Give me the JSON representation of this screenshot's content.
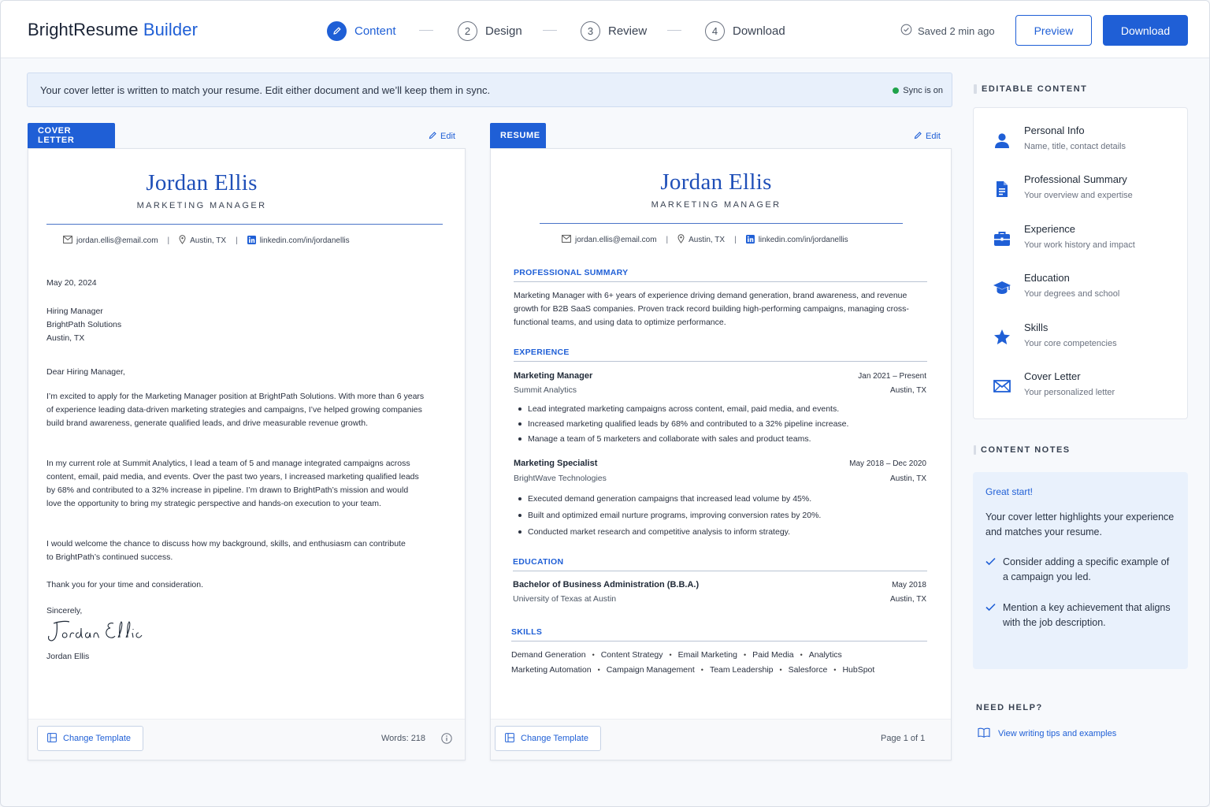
{
  "header": {
    "brand_main": "BrightResume",
    "brand_accent": "Builder",
    "steps": [
      {
        "num": "1",
        "label": "Content"
      },
      {
        "num": "2",
        "label": "Design"
      },
      {
        "num": "3",
        "label": "Review"
      },
      {
        "num": "4",
        "label": "Download"
      }
    ],
    "active_step": "Content",
    "saved_status": "Saved 2 min ago",
    "preview_label": "Preview",
    "download_label": "Download"
  },
  "banner": {
    "message": "Your cover letter is written to match your resume. Edit either document and we’ll keep them in sync.",
    "sync_label": "Sync is on",
    "sync_color": "#1fa34a"
  },
  "contact": {
    "name": "Jordan Ellis",
    "title": "MARKETING MANAGER",
    "email": "jordan.ellis@email.com",
    "location": "Austin, TX",
    "linkedin": "linkedin.com/in/jordanellis"
  },
  "cover_letter": {
    "tab_label": "COVER LETTER",
    "edit_label": "Edit",
    "date": "May 20, 2024",
    "recipient": [
      "Hiring Manager",
      "BrightPath Solutions",
      "Austin, TX"
    ],
    "salutation": "Dear Hiring Manager,",
    "paragraphs": [
      "I’m excited to apply for the Marketing Manager position at BrightPath Solutions. With more than 6 years of experience leading data-driven marketing strategies and campaigns, I’ve helped growing companies build brand awareness, generate qualified leads, and drive measurable revenue growth.",
      "In my current role at Summit Analytics, I lead a team of 5 and manage integrated campaigns across content, email, paid media, and events. Over the past two years, I increased marketing qualified leads by 68% and contributed to a 32% increase in pipeline. I’m drawn to BrightPath’s mission and would love the opportunity to bring my strategic perspective and hands-on execution to your team.",
      "I would welcome the chance to discuss how my background, skills, and enthusiasm can contribute to BrightPath’s continued success.",
      "Thank you for your time and consideration."
    ],
    "closing": "Sincerely,",
    "signature": "Jordan Ellis",
    "signed_name": "Jordan Ellis",
    "change_template_label": "Change Template",
    "word_count": "Words: 218"
  },
  "resume": {
    "tab_label": "RESUME",
    "edit_label": "Edit",
    "summary_heading": "PROFESSIONAL SUMMARY",
    "summary": "Marketing Manager with 6+ years of experience driving demand generation, brand awareness, and revenue growth for B2B SaaS companies. Proven track record building high-performing campaigns, managing cross-functional teams, and using data to optimize performance.",
    "experience_heading": "EXPERIENCE",
    "jobs": [
      {
        "title": "Marketing Manager",
        "company": "Summit Analytics",
        "dates": "Jan 2021 – Present",
        "location": "Austin, TX",
        "bullets": [
          "Lead integrated marketing campaigns across content, email, paid media, and events.",
          "Increased marketing qualified leads by 68% and contributed to a 32% pipeline increase.",
          "Manage a team of 5 marketers and collaborate with sales and product teams."
        ]
      },
      {
        "title": "Marketing Specialist",
        "company": "BrightWave Technologies",
        "dates": "May 2018 – Dec 2020",
        "location": "Austin, TX",
        "bullets": [
          "Executed demand generation campaigns that increased lead volume by 45%.",
          "Built and optimized email nurture programs, improving conversion rates by 20%.",
          "Conducted market research and competitive analysis to inform strategy."
        ]
      }
    ],
    "education_heading": "EDUCATION",
    "education": {
      "degree": "Bachelor of Business Administration (B.B.A.)",
      "school": "University of Texas at Austin",
      "date": "May 2018",
      "location": "Austin, TX"
    },
    "skills_heading": "SKILLS",
    "skills_row1": [
      "Demand Generation",
      "Content Strategy",
      "Email Marketing",
      "Paid Media",
      "Analytics"
    ],
    "skills_row2": [
      "Marketing Automation",
      "Campaign Management",
      "Team Leadership",
      "Salesforce",
      "HubSpot"
    ],
    "change_template_label": "Change Template",
    "page_info": "Page 1 of 1"
  },
  "sidebar": {
    "editable_heading": "EDITABLE CONTENT",
    "items": [
      {
        "title": "Personal Info",
        "subtitle": "Name, title, contact details",
        "icon": "person-icon"
      },
      {
        "title": "Professional Summary",
        "subtitle": "Your overview and expertise",
        "icon": "document-icon"
      },
      {
        "title": "Experience",
        "subtitle": "Your work history and impact",
        "icon": "briefcase-icon"
      },
      {
        "title": "Education",
        "subtitle": "Your degrees and school",
        "icon": "graduation-cap-icon"
      },
      {
        "title": "Skills",
        "subtitle": "Your core competencies",
        "icon": "star-icon"
      },
      {
        "title": "Cover Letter",
        "subtitle": "Your personalized letter",
        "icon": "envelope-icon"
      }
    ],
    "notes_heading": "CONTENT NOTES",
    "notes_title": "Great start!",
    "notes_text": "Your cover letter highlights your experience and matches your resume.",
    "notes_checks": [
      "Consider adding a specific example of a campaign you led.",
      "Mention a key achievement that aligns with the job description."
    ],
    "help_heading": "NEED HELP?",
    "help_link": "View writing tips and examples"
  },
  "colors": {
    "accent": "#1f5fd6",
    "name_blue": "#1f4fb8",
    "notes_bg": "#e9f1fc"
  }
}
